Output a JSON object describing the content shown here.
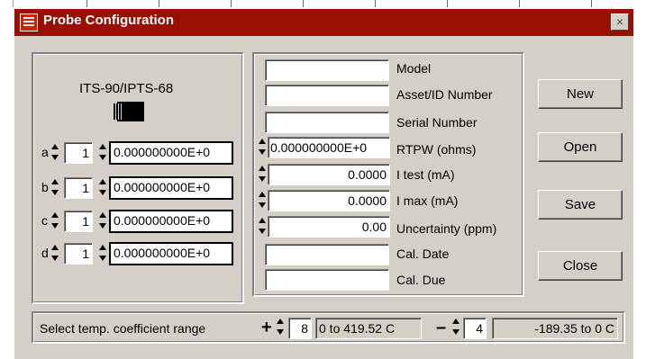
{
  "window": {
    "title": "Probe Configuration",
    "close_glyph": "×"
  },
  "icons": {
    "app": "probe-app-icon",
    "sensor": "sensor-chip-icon",
    "close": "close-icon"
  },
  "left_panel": {
    "standard": "ITS-90/IPTS-68",
    "coefficients": [
      {
        "label": "a",
        "index": "1",
        "value": "0.000000000E+0"
      },
      {
        "label": "b",
        "index": "1",
        "value": "0.000000000E+0"
      },
      {
        "label": "c",
        "index": "1",
        "value": "0.000000000E+0"
      },
      {
        "label": "d",
        "index": "1",
        "value": "0.000000000E+0"
      }
    ]
  },
  "middle_panel": {
    "model": {
      "label": "Model",
      "value": ""
    },
    "asset": {
      "label": "Asset/ID Number",
      "value": ""
    },
    "serial": {
      "label": "Serial Number",
      "value": ""
    },
    "rtpw": {
      "label": "RTPW (ohms)",
      "value": "0.000000000E+0"
    },
    "i_test": {
      "label": "I test (mA)",
      "value": "0.0000"
    },
    "i_max": {
      "label": "I max (mA)",
      "value": "0.0000"
    },
    "uncertainty": {
      "label": "Uncertainty (ppm)",
      "value": "0.00"
    },
    "cal_date": {
      "label": "Cal. Date",
      "value": ""
    },
    "cal_due": {
      "label": "Cal. Due",
      "value": ""
    }
  },
  "buttons": {
    "new": "New",
    "open": "Open",
    "save": "Save",
    "close": "Close"
  },
  "bottom": {
    "label": "Select temp. coefficient range",
    "plus_sign": "+",
    "plus_index": "8",
    "plus_range": "0 to 419.52 C",
    "minus_sign": "–",
    "minus_index": "4",
    "minus_range": "-189.35 to 0 C"
  }
}
